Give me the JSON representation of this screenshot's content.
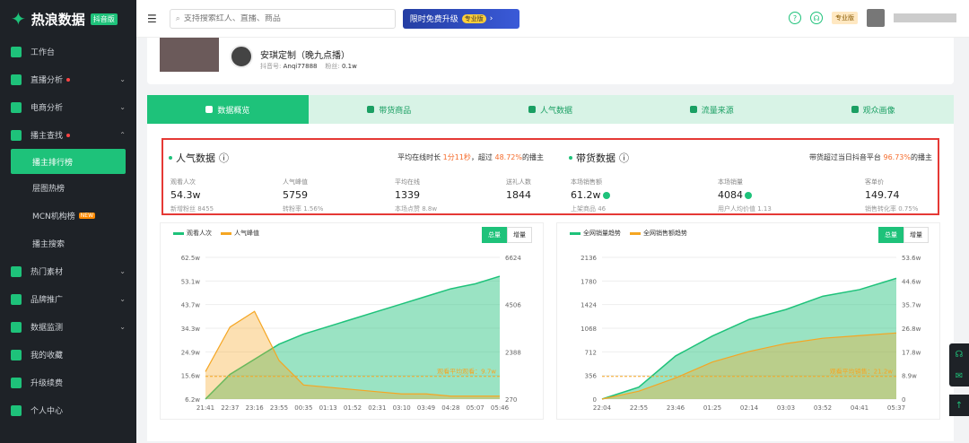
{
  "brand": {
    "name": "热浪数据",
    "edition": "抖音版"
  },
  "sidebar": {
    "items": [
      {
        "label": "工作台"
      },
      {
        "label": "直播分析"
      },
      {
        "label": "电商分析"
      },
      {
        "label": "播主查找"
      },
      {
        "label": "热门素材"
      },
      {
        "label": "品牌推广"
      },
      {
        "label": "数据监测"
      },
      {
        "label": "我的收藏"
      },
      {
        "label": "升级续费"
      },
      {
        "label": "个人中心"
      }
    ],
    "sub": [
      {
        "label": "播主排行榜"
      },
      {
        "label": "层图热榜"
      },
      {
        "label": "MCN机构榜",
        "badge": "NEW"
      },
      {
        "label": "播主搜索"
      }
    ]
  },
  "topbar": {
    "search_placeholder": "支持搜索红人、直播、商品",
    "promo": "限时免费升级",
    "promo_tag": "专业版",
    "pro": "专业版"
  },
  "profile": {
    "name": "安琪定制（晚九点播）",
    "douyin_label": "抖音号:",
    "douyin_id": "Anqi77888",
    "fans_label": "粉丝:",
    "fans": "0.1w"
  },
  "tabs": [
    {
      "label": "数据概览"
    },
    {
      "label": "带货商品"
    },
    {
      "label": "人气数据"
    },
    {
      "label": "流量来源"
    },
    {
      "label": "观众画像"
    }
  ],
  "popularity": {
    "title": "人气数据",
    "summary_pre": "平均在线时长 ",
    "summary_time": "1分11秒",
    "summary_mid": "，超过 ",
    "summary_pct": "48.72%",
    "summary_post": "的播主",
    "metrics": [
      {
        "label": "观看人次",
        "value": "54.3w",
        "sub": "新增粉丝 8455"
      },
      {
        "label": "人气峰值",
        "value": "5759",
        "sub": "转粉率 1.56%"
      },
      {
        "label": "平均在线",
        "value": "1339",
        "sub": "本场点赞 8.8w"
      },
      {
        "label": "送礼人数",
        "value": "1844",
        "sub": ""
      }
    ]
  },
  "goods": {
    "title": "带货数据",
    "summary_pre": "带货超过当日抖音平台 ",
    "summary_pct": "96.73%",
    "summary_post": "的播主",
    "metrics": [
      {
        "label": "本场销售额",
        "value": "61.2w",
        "sub": "上架商品 46"
      },
      {
        "label": "本场销量",
        "value": "4084",
        "sub": "用户人均价值 1.13"
      },
      {
        "label": "客单价",
        "value": "149.74",
        "sub": "销售转化率 0.75%"
      }
    ]
  },
  "chart_left": {
    "legend": [
      "观看人次",
      "人气峰值"
    ],
    "toggle": [
      "总量",
      "增量"
    ],
    "annotation": "观看平均观看：9.7w"
  },
  "chart_right": {
    "legend": [
      "全网销量趋势",
      "全网销售额趋势"
    ],
    "toggle": [
      "总量",
      "增量"
    ],
    "annotation": "观看平均销售：21.2w"
  },
  "chart_data": [
    {
      "type": "area",
      "x": [
        "21:41",
        "22:37",
        "23:16",
        "23:55",
        "00:35",
        "01:13",
        "01:52",
        "02:31",
        "03:10",
        "03:49",
        "04:28",
        "05:07",
        "05:46"
      ],
      "yticks_left": [
        "6.2w",
        "15.6w",
        "24.9w",
        "34.3w",
        "43.7w",
        "53.1w",
        "62.5w"
      ],
      "yticks_right": [
        "270",
        "2388",
        "4506",
        "6624"
      ],
      "ylim_left": [
        6.2,
        62.5
      ],
      "ylim_right": [
        270,
        6624
      ],
      "series": [
        {
          "name": "观看人次",
          "color": "#1ec27a",
          "values": [
            6.2,
            16,
            22,
            28,
            32,
            35,
            38,
            41,
            44,
            47,
            50,
            52,
            55
          ]
        },
        {
          "name": "人气峰值",
          "color": "#f5a623",
          "values": [
            1500,
            3500,
            4200,
            2000,
            900,
            800,
            700,
            600,
            500,
            500,
            400,
            400,
            400
          ]
        }
      ]
    },
    {
      "type": "area",
      "x": [
        "22:04",
        "22:55",
        "23:46",
        "01:25",
        "02:14",
        "03:03",
        "03:52",
        "04:41",
        "05:37"
      ],
      "yticks_left": [
        "0",
        "356",
        "712",
        "1068",
        "1424",
        "1780",
        "2136"
      ],
      "yticks_right": [
        "0",
        "8.9w",
        "17.8w",
        "26.8w",
        "35.7w",
        "44.6w",
        "53.6w"
      ],
      "ylim_left": [
        0,
        2136
      ],
      "ylim_right": [
        0,
        53.6
      ],
      "series": [
        {
          "name": "全网销量趋势",
          "color": "#1ec27a",
          "values": [
            0,
            180,
            650,
            950,
            1200,
            1350,
            1550,
            1650,
            1820
          ]
        },
        {
          "name": "全网销售额趋势",
          "color": "#f5a623",
          "values": [
            0,
            3,
            8,
            14,
            18,
            21,
            23,
            24,
            25
          ]
        }
      ]
    }
  ]
}
